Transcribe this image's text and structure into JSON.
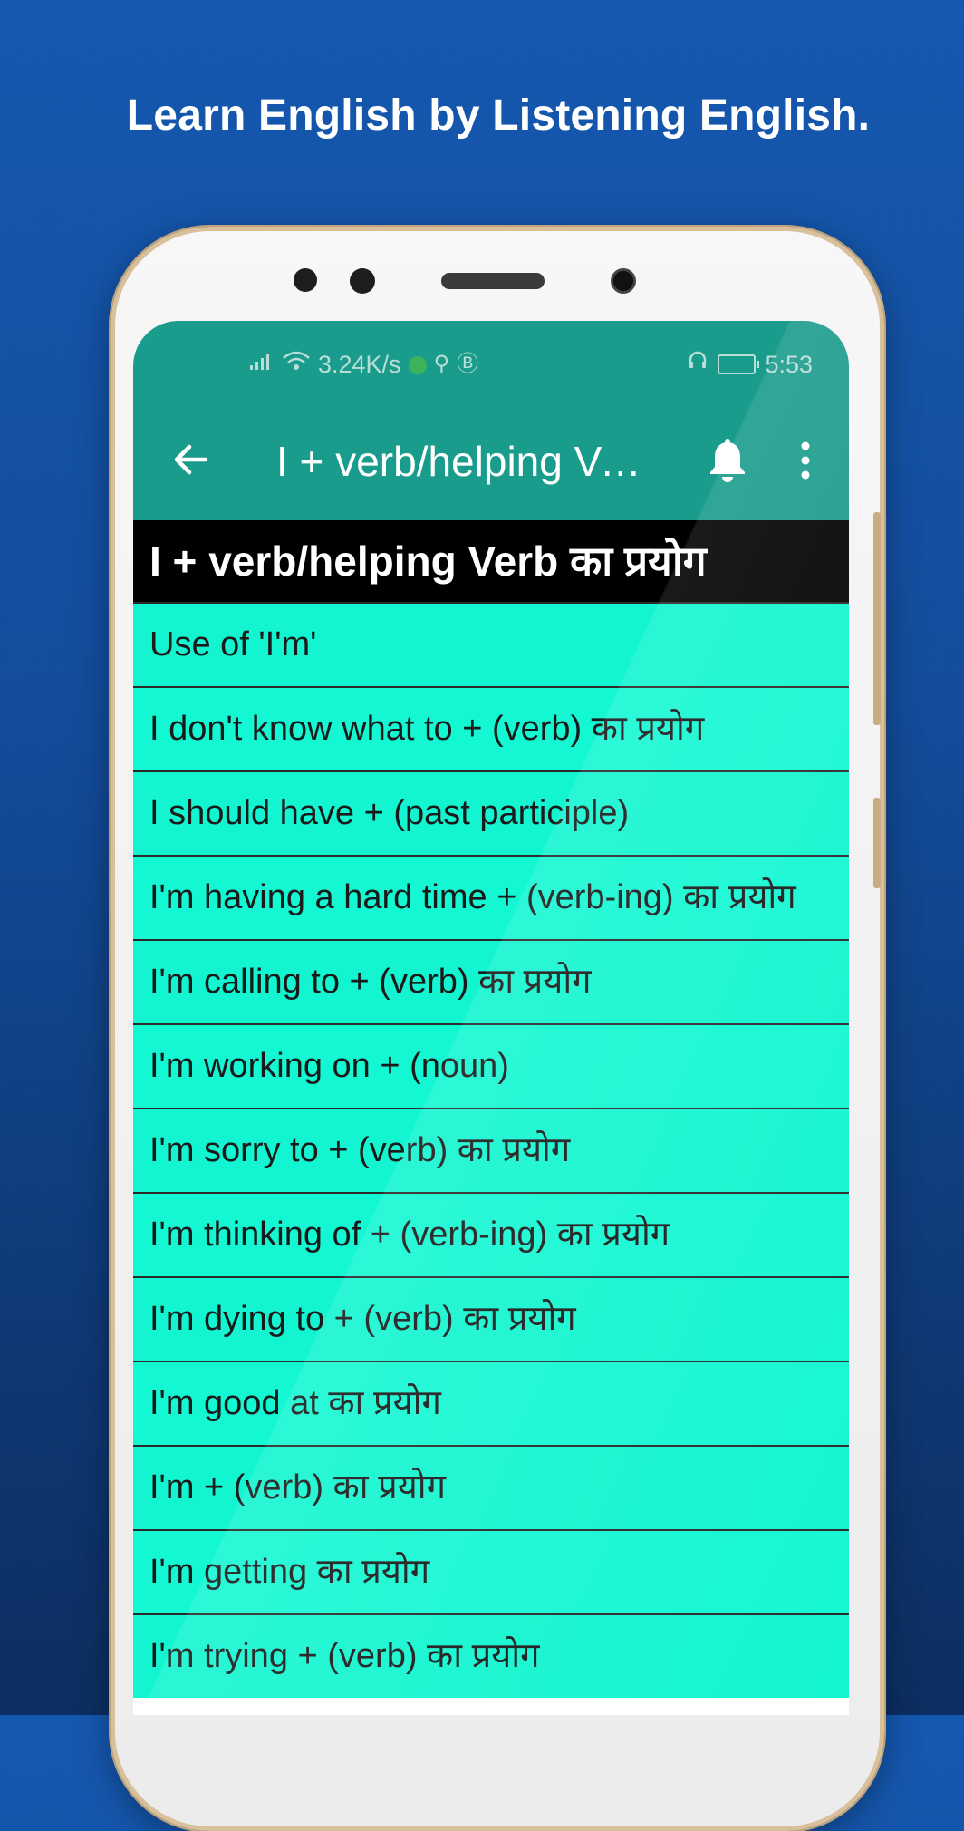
{
  "promo": {
    "title": "Learn English by Listening English."
  },
  "statusbar": {
    "speed": "3.24K/s",
    "time": "5:53"
  },
  "toolbar": {
    "title": "I + verb/helping Ver…"
  },
  "section": {
    "header": "I + verb/helping Verb का प्रयोग"
  },
  "list": {
    "items": [
      "Use of 'I'm'",
      "I don't know what to + (verb) का प्रयोग",
      "I should have + (past participle)",
      "I'm having a hard time + (verb-ing) का प्रयोग",
      "I'm calling to + (verb) का प्रयोग",
      "I'm working on + (noun)",
      "I'm sorry to + (verb) का प्रयोग",
      "I'm thinking of + (verb-ing) का प्रयोग",
      "I'm dying to + (verb) का प्रयोग",
      "I'm good at का प्रयोग",
      "I'm + (verb) का प्रयोग",
      "I'm getting का प्रयोग",
      "I'm trying + (verb) का प्रयोग"
    ]
  },
  "colors": {
    "background": "#1558b0",
    "appbar": "#1a9c8c",
    "list_row": "#12f5d0",
    "header_bg": "#000000"
  },
  "icons": {
    "back": "arrow-left-icon",
    "bell": "bell-icon",
    "menu": "more-vert-icon"
  }
}
